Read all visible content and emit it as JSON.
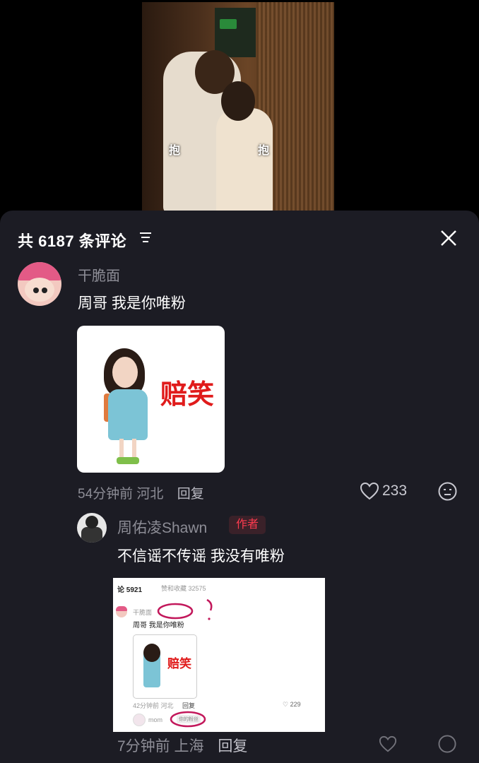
{
  "video": {
    "subtitle_left": "抱",
    "subtitle_right": "抱"
  },
  "header": {
    "title": "共 6187 条评论"
  },
  "comment": {
    "username": "干脆面",
    "text": "周哥 我是你唯粉",
    "sticker_text": "赔笑",
    "time": "54分钟前",
    "location": "河北",
    "reply_label": "回复",
    "likes": "233"
  },
  "reply": {
    "username": "周佑凌Shawn",
    "badge": "作者",
    "text": "不信谣不传谣 我没有唯粉",
    "time": "7分钟前",
    "location": "上海",
    "reply_label": "回复"
  },
  "screenshot": {
    "header_left": "论 5921",
    "header_right": "赞和收藏 32575",
    "username": "干脆面",
    "text": "周哥 我是你唯粉",
    "sticker_text": "赔笑",
    "meta": "42分钟前 河北",
    "reply_label": "回复",
    "likes": "229",
    "reply_user": "mom",
    "tag": "你的粉丝"
  }
}
